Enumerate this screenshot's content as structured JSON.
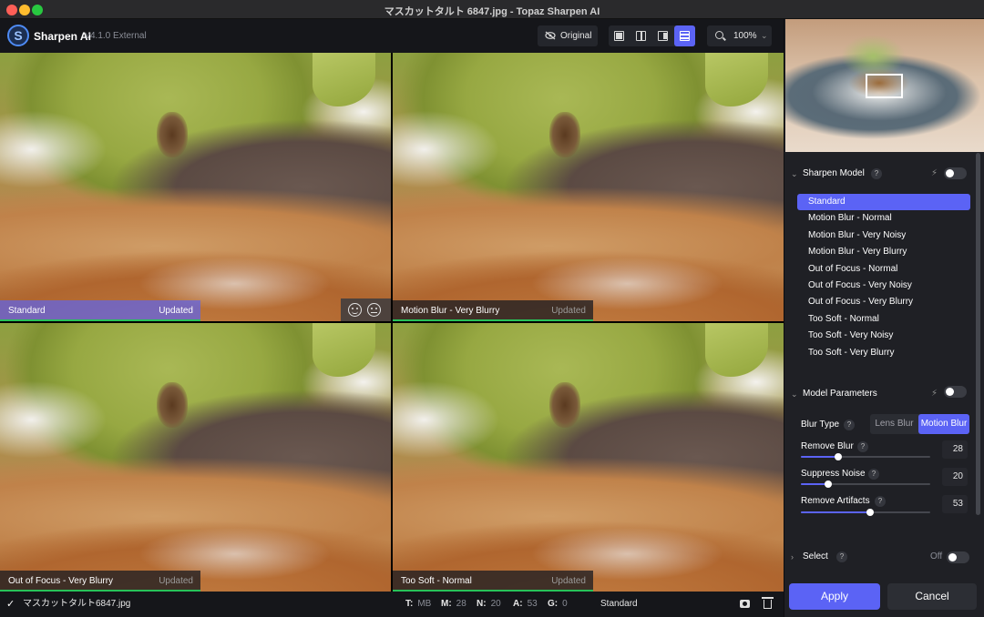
{
  "window": {
    "title": "マスカットタルト 6847.jpg - Topaz Sharpen AI"
  },
  "app": {
    "logo_letter": "S",
    "name": "Sharpen AI",
    "version": "v4.1.0 External"
  },
  "toolbar": {
    "original_label": "Original",
    "view_modes": [
      "single-view",
      "split-view",
      "side-by-side-view",
      "quad-view"
    ],
    "active_view": "quad-view",
    "zoom": "100%"
  },
  "panes": [
    {
      "name": "Standard",
      "status": "Updated",
      "active": true
    },
    {
      "name": "Motion Blur - Very Blurry",
      "status": "Updated",
      "active": false
    },
    {
      "name": "Out of Focus - Very Blurry",
      "status": "Updated",
      "active": false
    },
    {
      "name": "Too Soft - Normal",
      "status": "Updated",
      "active": false
    }
  ],
  "statusbar": {
    "filename": "マスカットタルト6847.jpg",
    "stats": [
      {
        "key": "T:",
        "value": "MB"
      },
      {
        "key": "M:",
        "value": "28"
      },
      {
        "key": "N:",
        "value": "20"
      },
      {
        "key": "A:",
        "value": "53"
      },
      {
        "key": "G:",
        "value": "0"
      }
    ],
    "model": "Standard"
  },
  "sharpen_model": {
    "title": "Sharpen Model",
    "help": "?",
    "items": [
      "Standard",
      "Motion Blur - Normal",
      "Motion Blur - Very Noisy",
      "Motion Blur - Very Blurry",
      "Out of Focus - Normal",
      "Out of Focus - Very Noisy",
      "Out of Focus - Very Blurry",
      "Too Soft - Normal",
      "Too Soft - Very Noisy",
      "Too Soft - Very Blurry"
    ],
    "selected": "Standard"
  },
  "model_parameters": {
    "title": "Model Parameters",
    "help": "?",
    "blur_type_label": "Blur Type",
    "blur_type_options": [
      "Lens Blur",
      "Motion Blur"
    ],
    "blur_type_selected": "Motion Blur",
    "remove_blur": {
      "label": "Remove Blur",
      "value": "28"
    },
    "suppress_noise": {
      "label": "Suppress Noise",
      "value": "20"
    },
    "remove_artifacts": {
      "label": "Remove Artifacts",
      "value": "53"
    }
  },
  "select_section": {
    "title": "Select",
    "help": "?",
    "state": "Off"
  },
  "actions": {
    "apply": "Apply",
    "cancel": "Cancel"
  },
  "colors": {
    "accent": "#5b63f5",
    "progress": "#27c259",
    "panel_bg": "#1f2025"
  }
}
